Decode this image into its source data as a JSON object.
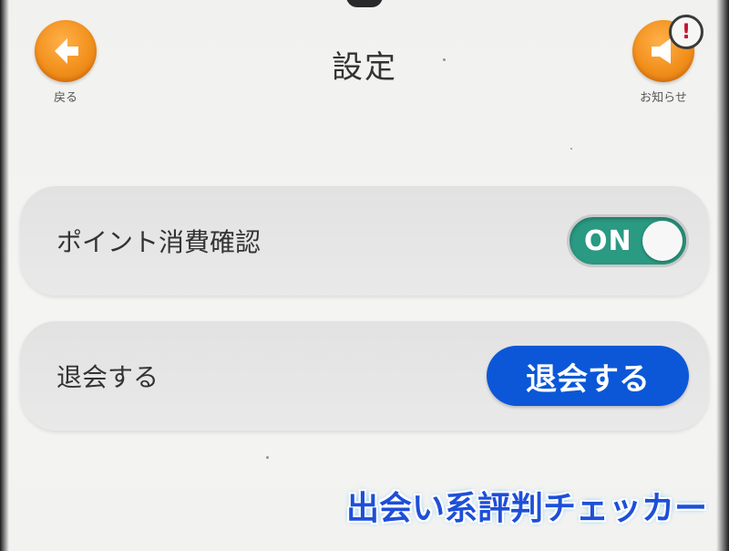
{
  "header": {
    "title": "設定",
    "back_label": "戻る",
    "notice_label": "お知らせ",
    "notice_badge": "!"
  },
  "settings": {
    "point_confirm": {
      "label": "ポイント消費確認",
      "toggle_state": "ON"
    },
    "withdraw": {
      "label": "退会する",
      "button_label": "退会する"
    }
  },
  "watermark": "出会い系評判チェッカー",
  "icons": {
    "back": "arrow-left-icon",
    "notice": "speaker-icon",
    "badge": "exclamation-icon"
  },
  "colors": {
    "orange": "#f2901c",
    "toggle_on": "#2a9a82",
    "withdraw_button": "#0b57d8",
    "alert": "#c8102e",
    "watermark": "#1e4fd8"
  }
}
